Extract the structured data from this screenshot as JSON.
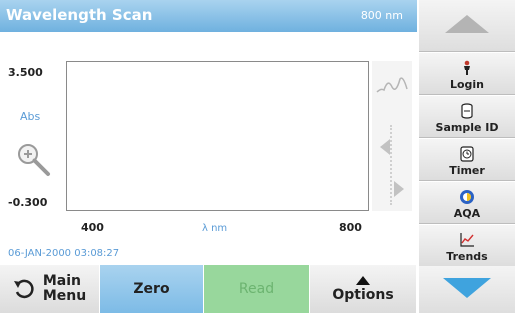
{
  "header": {
    "title": "Wavelength Scan",
    "wavelength": "800 nm"
  },
  "plot": {
    "y_max": "3.500",
    "y_label": "Abs",
    "y_min": "-0.300",
    "x_min": "400",
    "x_label": "λ nm",
    "x_max": "800"
  },
  "datetime": "06-JAN-2000  03:08:27",
  "icons": {
    "zoom": "zoom-in-icon",
    "wave": "wave-icon",
    "scroll_left": "arrow-left-icon",
    "scroll_right": "arrow-right-icon",
    "back": "back-arrow-icon",
    "options": "triangle-up-icon",
    "up": "triangle-up-icon",
    "down": "triangle-down-icon",
    "login": "person-icon",
    "sample_id": "cylinder-icon",
    "timer": "timer-icon",
    "aqa": "aqa-icon",
    "trends": "chart-icon"
  },
  "bottom_bar": {
    "main_menu": "Main Menu",
    "main_menu_line1": "Main",
    "main_menu_line2": "Menu",
    "zero": "Zero",
    "read": "Read",
    "options": "Options"
  },
  "side_menu": {
    "login": "Login",
    "sample_id": "Sample ID",
    "timer": "Timer",
    "aqa": "AQA",
    "trends": "Trends"
  },
  "colors": {
    "header": "#6fb1df",
    "accent_blue": "#5a9bd6",
    "read_green": "#98d79c",
    "nav_down": "#3fa3de"
  }
}
